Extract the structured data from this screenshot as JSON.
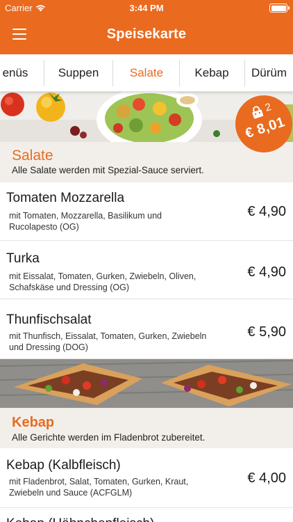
{
  "status": {
    "carrier": "Carrier",
    "time": "3:44 PM"
  },
  "header": {
    "title": "Speisekarte"
  },
  "tabs": [
    {
      "label": "Menüs",
      "shown": "enüs"
    },
    {
      "label": "Suppen"
    },
    {
      "label": "Salate"
    },
    {
      "label": "Kebap"
    },
    {
      "label": "Dürüm"
    }
  ],
  "cart": {
    "count": "2",
    "total": "€ 8,01"
  },
  "sections": [
    {
      "title": "Salate",
      "subtitle": "Alle Salate werden mit Spezial-Sauce serviert.",
      "items": [
        {
          "name": "Tomaten Mozzarella",
          "desc": "mit Tomaten, Mozzarella, Basilikum und Rucolapesto (OG)",
          "price": "€ 4,90"
        },
        {
          "name": "Turka",
          "desc": "mit Eissalat, Tomaten, Gurken, Zwiebeln, Oliven, Schafskäse und Dressing (OG)",
          "price": "€ 4,90"
        },
        {
          "name": "Thunfischsalat",
          "desc": "mit Thunfisch, Eissalat, Tomaten, Gurken, Zwiebeln und Dressing (DOG)",
          "price": "€ 5,90"
        }
      ]
    },
    {
      "title": "Kebap",
      "subtitle": "Alle Gerichte werden im Fladenbrot zubereitet.",
      "items": [
        {
          "name": "Kebap (Kalbfleisch)",
          "desc": "mit Fladenbrot, Salat, Tomaten, Gurken, Kraut, Zwiebeln und Sauce (ACFGLM)",
          "price": "€ 4,00"
        },
        {
          "name": "Kebap (Hähnchenfleisch)",
          "desc": "",
          "price": ""
        }
      ]
    }
  ],
  "colors": {
    "accent": "#e96b20",
    "header": "#ea6a1f",
    "section_bg": "#f2efea"
  },
  "icons": [
    "wifi-icon",
    "battery-icon",
    "hamburger-menu-icon",
    "shopping-bag-icon"
  ]
}
